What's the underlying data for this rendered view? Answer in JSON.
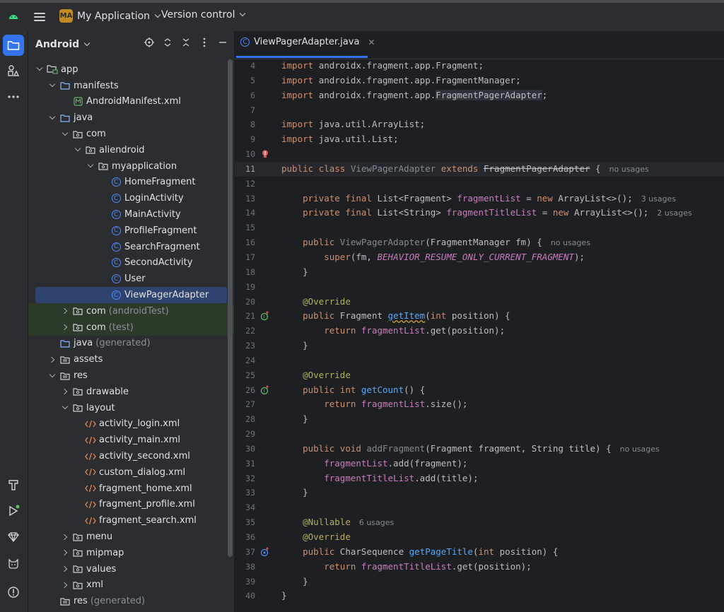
{
  "topbar": {
    "project_badge": "MA",
    "project_name": "My Application",
    "version_control": "Version control"
  },
  "project_panel": {
    "title": "Android",
    "tree": [
      {
        "label": "app",
        "depth": 0,
        "arrow": "d",
        "icon": "module-folder-icon"
      },
      {
        "label": "manifests",
        "depth": 1,
        "arrow": "d",
        "icon": "folder-icon"
      },
      {
        "label": "AndroidManifest.xml",
        "depth": 2,
        "arrow": "",
        "icon": "manifest-file-icon"
      },
      {
        "label": "java",
        "depth": 1,
        "arrow": "d",
        "icon": "folder-icon"
      },
      {
        "label": "com",
        "depth": 2,
        "arrow": "d",
        "icon": "package-icon"
      },
      {
        "label": "aliendroid",
        "depth": 3,
        "arrow": "d",
        "icon": "package-icon"
      },
      {
        "label": "myapplication",
        "depth": 4,
        "arrow": "d",
        "icon": "package-icon"
      },
      {
        "label": "HomeFragment",
        "depth": 5,
        "arrow": "",
        "icon": "class-icon"
      },
      {
        "label": "LoginActivity",
        "depth": 5,
        "arrow": "",
        "icon": "class-icon"
      },
      {
        "label": "MainActivity",
        "depth": 5,
        "arrow": "",
        "icon": "class-icon"
      },
      {
        "label": "ProfileFragment",
        "depth": 5,
        "arrow": "",
        "icon": "class-icon"
      },
      {
        "label": "SearchFragment",
        "depth": 5,
        "arrow": "",
        "icon": "class-icon"
      },
      {
        "label": "SecondActivity",
        "depth": 5,
        "arrow": "",
        "icon": "class-icon"
      },
      {
        "label": "User",
        "depth": 5,
        "arrow": "",
        "icon": "class-icon"
      },
      {
        "label": "ViewPagerAdapter",
        "depth": 5,
        "arrow": "",
        "icon": "class-icon",
        "selected": true
      },
      {
        "label": "com",
        "suffix": "(androidTest)",
        "depth": 2,
        "arrow": "r",
        "icon": "package-icon",
        "tint": true
      },
      {
        "label": "com",
        "suffix": "(test)",
        "depth": 2,
        "arrow": "r",
        "icon": "package-icon",
        "tint": true
      },
      {
        "label": "java",
        "suffix": "(generated)",
        "depth": 1,
        "arrow": "",
        "icon": "generated-folder-icon"
      },
      {
        "label": "assets",
        "depth": 1,
        "arrow": "r",
        "icon": "res-folder-icon"
      },
      {
        "label": "res",
        "depth": 1,
        "arrow": "d",
        "icon": "res-folder-icon"
      },
      {
        "label": "drawable",
        "depth": 2,
        "arrow": "r",
        "icon": "package-icon"
      },
      {
        "label": "layout",
        "depth": 2,
        "arrow": "d",
        "icon": "package-icon"
      },
      {
        "label": "activity_login.xml",
        "depth": 3,
        "arrow": "",
        "icon": "xml-file-icon"
      },
      {
        "label": "activity_main.xml",
        "depth": 3,
        "arrow": "",
        "icon": "xml-file-icon"
      },
      {
        "label": "activity_second.xml",
        "depth": 3,
        "arrow": "",
        "icon": "xml-file-icon"
      },
      {
        "label": "custom_dialog.xml",
        "depth": 3,
        "arrow": "",
        "icon": "xml-file-icon"
      },
      {
        "label": "fragment_home.xml",
        "depth": 3,
        "arrow": "",
        "icon": "xml-file-icon"
      },
      {
        "label": "fragment_profile.xml",
        "depth": 3,
        "arrow": "",
        "icon": "xml-file-icon"
      },
      {
        "label": "fragment_search.xml",
        "depth": 3,
        "arrow": "",
        "icon": "xml-file-icon"
      },
      {
        "label": "menu",
        "depth": 2,
        "arrow": "r",
        "icon": "package-icon"
      },
      {
        "label": "mipmap",
        "depth": 2,
        "arrow": "r",
        "icon": "package-icon"
      },
      {
        "label": "values",
        "depth": 2,
        "arrow": "r",
        "icon": "package-icon"
      },
      {
        "label": "xml",
        "depth": 2,
        "arrow": "r",
        "icon": "package-icon"
      },
      {
        "label": "res",
        "suffix": "(generated)",
        "depth": 1,
        "arrow": "",
        "icon": "res-folder-icon"
      }
    ]
  },
  "editor": {
    "tab_label": "ViewPagerAdapter.java",
    "lines": [
      {
        "n": "4",
        "tokens": [
          [
            "kw",
            "import "
          ],
          [
            "",
            "androidx.fragment.app.Fragment;"
          ]
        ]
      },
      {
        "n": "5",
        "tokens": [
          [
            "kw",
            "import "
          ],
          [
            "",
            "androidx.fragment.app.FragmentManager;"
          ]
        ]
      },
      {
        "n": "6",
        "tokens": [
          [
            "kw",
            "import "
          ],
          [
            "",
            "androidx.fragment.app."
          ],
          [
            "hl",
            "FragmentPagerAdapter"
          ],
          [
            "",
            ";"
          ]
        ]
      },
      {
        "n": "7",
        "tokens": []
      },
      {
        "n": "8",
        "tokens": [
          [
            "kw",
            "import "
          ],
          [
            "",
            "java.util.ArrayList;"
          ]
        ]
      },
      {
        "n": "9",
        "tokens": [
          [
            "kw",
            "import "
          ],
          [
            "",
            "java.util.List;"
          ]
        ]
      },
      {
        "n": "10",
        "tokens": [],
        "gutter": "bulb"
      },
      {
        "n": "11",
        "tokens": [
          [
            "kw",
            "public class "
          ],
          [
            "gr",
            "ViewPagerAdapter "
          ],
          [
            "kw",
            "extends "
          ],
          [
            "strk",
            "FragmentPagerAdapter"
          ],
          [
            "",
            " {"
          ]
        ],
        "hint": "no usages",
        "current": true
      },
      {
        "n": "12",
        "tokens": []
      },
      {
        "n": "13",
        "tokens": [
          [
            "",
            "    "
          ],
          [
            "kw",
            "private final "
          ],
          [
            "",
            "List<Fragment> "
          ],
          [
            "fld",
            "fragmentList"
          ],
          [
            "",
            " = "
          ],
          [
            "kw",
            "new "
          ],
          [
            "",
            "ArrayList<>();"
          ]
        ],
        "hint": "3 usages"
      },
      {
        "n": "14",
        "tokens": [
          [
            "",
            "    "
          ],
          [
            "kw",
            "private final "
          ],
          [
            "",
            "List<String> "
          ],
          [
            "fld",
            "fragmentTitleList"
          ],
          [
            "",
            " = "
          ],
          [
            "kw",
            "new "
          ],
          [
            "",
            "ArrayList<>();"
          ]
        ],
        "hint": "2 usages"
      },
      {
        "n": "15",
        "tokens": []
      },
      {
        "n": "16",
        "tokens": [
          [
            "",
            "    "
          ],
          [
            "kw",
            "public "
          ],
          [
            "gr",
            "ViewPagerAdapter"
          ],
          [
            "",
            "(FragmentManager fm) {"
          ]
        ],
        "hint": "no usages"
      },
      {
        "n": "17",
        "tokens": [
          [
            "",
            "        "
          ],
          [
            "kw",
            "super"
          ],
          [
            "",
            "(fm, "
          ],
          [
            "cst",
            "BEHAVIOR_RESUME_ONLY_CURRENT_FRAGMENT"
          ],
          [
            "",
            ");"
          ]
        ]
      },
      {
        "n": "18",
        "tokens": [
          [
            "",
            "    }"
          ]
        ]
      },
      {
        "n": "19",
        "tokens": []
      },
      {
        "n": "20",
        "tokens": [
          [
            "",
            "    "
          ],
          [
            "ann",
            "@Override"
          ]
        ]
      },
      {
        "n": "21",
        "tokens": [
          [
            "",
            "    "
          ],
          [
            "kw",
            "public "
          ],
          [
            "",
            "Fragment "
          ],
          [
            "fn warn",
            "getItem"
          ],
          [
            "",
            "("
          ],
          [
            "kw",
            "int "
          ],
          [
            "",
            "position) {"
          ]
        ],
        "gutter": "override"
      },
      {
        "n": "22",
        "tokens": [
          [
            "",
            "        "
          ],
          [
            "kw",
            "return "
          ],
          [
            "fld",
            "fragmentList"
          ],
          [
            "",
            ".get(position);"
          ]
        ]
      },
      {
        "n": "23",
        "tokens": [
          [
            "",
            "    }"
          ]
        ]
      },
      {
        "n": "24",
        "tokens": []
      },
      {
        "n": "25",
        "tokens": [
          [
            "",
            "    "
          ],
          [
            "ann",
            "@Override"
          ]
        ]
      },
      {
        "n": "26",
        "tokens": [
          [
            "",
            "    "
          ],
          [
            "kw",
            "public int "
          ],
          [
            "fn",
            "getCount"
          ],
          [
            "",
            "() {"
          ]
        ],
        "gutter": "override"
      },
      {
        "n": "27",
        "tokens": [
          [
            "",
            "        "
          ],
          [
            "kw",
            "return "
          ],
          [
            "fld",
            "fragmentList"
          ],
          [
            "",
            ".size();"
          ]
        ]
      },
      {
        "n": "28",
        "tokens": [
          [
            "",
            "    }"
          ]
        ]
      },
      {
        "n": "29",
        "tokens": []
      },
      {
        "n": "30",
        "tokens": [
          [
            "",
            "    "
          ],
          [
            "kw",
            "public void "
          ],
          [
            "gr",
            "addFragment"
          ],
          [
            "",
            "(Fragment fragment, String title) {"
          ]
        ],
        "hint": "no usages"
      },
      {
        "n": "31",
        "tokens": [
          [
            "",
            "        "
          ],
          [
            "fld",
            "fragmentList"
          ],
          [
            "",
            ".add(fragment);"
          ]
        ]
      },
      {
        "n": "32",
        "tokens": [
          [
            "",
            "        "
          ],
          [
            "fld",
            "fragmentTitleList"
          ],
          [
            "",
            ".add(title);"
          ]
        ]
      },
      {
        "n": "33",
        "tokens": [
          [
            "",
            "    }"
          ]
        ]
      },
      {
        "n": "34",
        "tokens": []
      },
      {
        "n": "35",
        "tokens": [
          [
            "",
            "    "
          ],
          [
            "ann",
            "@Nullable"
          ]
        ],
        "hint": "6 usages"
      },
      {
        "n": "36",
        "tokens": [
          [
            "",
            "    "
          ],
          [
            "ann",
            "@Override"
          ]
        ]
      },
      {
        "n": "37",
        "tokens": [
          [
            "",
            "    "
          ],
          [
            "kw",
            "public "
          ],
          [
            "",
            "CharSequence "
          ],
          [
            "fn",
            "getPageTitle"
          ],
          [
            "",
            "("
          ],
          [
            "kw",
            "int "
          ],
          [
            "",
            "position) {"
          ]
        ],
        "gutter": "implements"
      },
      {
        "n": "38",
        "tokens": [
          [
            "",
            "        "
          ],
          [
            "kw",
            "return "
          ],
          [
            "fld",
            "fragmentTitleList"
          ],
          [
            "",
            ".get(position);"
          ]
        ]
      },
      {
        "n": "39",
        "tokens": [
          [
            "",
            "    }"
          ]
        ]
      },
      {
        "n": "40",
        "tokens": [
          [
            "",
            "}"
          ]
        ]
      }
    ]
  },
  "colors": {
    "accent": "#3574f0",
    "keyword": "#cf8e6d",
    "field": "#c77dbb",
    "method": "#56a8f5",
    "annotation": "#b3ae60"
  }
}
